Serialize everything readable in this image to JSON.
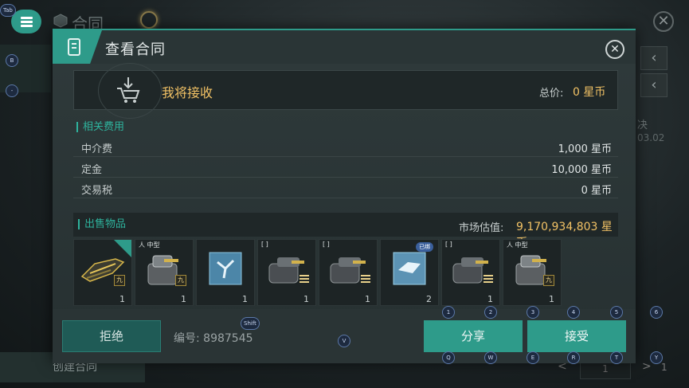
{
  "background": {
    "title": "合同",
    "create_label": "创建合同",
    "side_text_1": "决",
    "side_text_2": "03.02",
    "pager_prev": "<",
    "pager_value": "1",
    "pager_next": ">",
    "pager_total": "1"
  },
  "menu": {
    "hotkey": "Tab"
  },
  "modal": {
    "title": "查看合同",
    "close_glyph": "✕",
    "receive": {
      "label": "我将接收",
      "total_label": "总价:",
      "total_value": "0 星币"
    },
    "fees": {
      "header": "相关费用",
      "rows": [
        {
          "name": "中介费",
          "value": "1,000 星币"
        },
        {
          "name": "定金",
          "value": "10,000 星币"
        },
        {
          "name": "交易税",
          "value": "0 星币"
        }
      ]
    },
    "sell": {
      "header": "出售物品",
      "market_label": "市场估值:",
      "market_value": "9,170,934,803 星币"
    },
    "items": [
      {
        "qty": "1",
        "tag": "",
        "grade": "九",
        "kind": "ship",
        "badge": "true"
      },
      {
        "qty": "1",
        "tag": "人 中型",
        "grade": "九",
        "kind": "turret"
      },
      {
        "qty": "1",
        "tag": "",
        "grade": "",
        "kind": "blueprint"
      },
      {
        "qty": "1",
        "tag": "[ ]",
        "grade": "",
        "kind": "cannon",
        "bars": "true"
      },
      {
        "qty": "1",
        "tag": "[ ]",
        "grade": "",
        "kind": "cannon",
        "bars": "true"
      },
      {
        "qty": "2",
        "tag": "",
        "grade": "",
        "kind": "blueprint2",
        "cert": "已绑"
      },
      {
        "qty": "1",
        "tag": "[ ]",
        "grade": "",
        "kind": "cannon",
        "bars": "true"
      },
      {
        "qty": "1",
        "tag": "人 中型",
        "grade": "九",
        "kind": "turret"
      }
    ],
    "footer": {
      "reject_label": "拒绝",
      "serial_text": "编号: 8987545",
      "share_label": "分享",
      "accept_label": "接受"
    }
  },
  "hotkeys": {
    "left_1": "B",
    "left_2": "-",
    "shift": "Shift",
    "v": "V",
    "r1": "1",
    "r2": "2",
    "r3": "3",
    "r4": "4",
    "r5": "5",
    "r6": "6",
    "q": "Q",
    "w": "W",
    "e": "E",
    "r": "R",
    "t": "T",
    "y": "Y"
  },
  "colors": {
    "accent": "#2e9b8a",
    "gold": "#f2c265",
    "panel": "#263031"
  }
}
